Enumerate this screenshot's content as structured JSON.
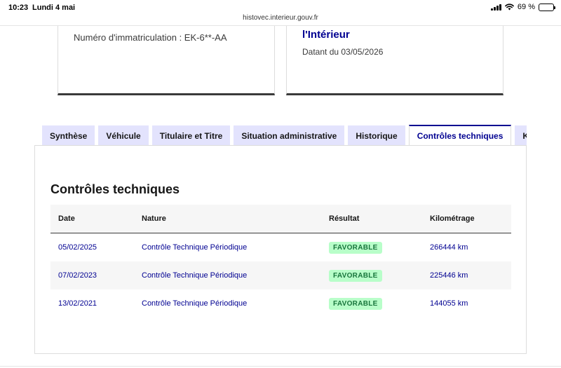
{
  "status_bar": {
    "time": "10:23",
    "date": "Lundi 4 mai",
    "battery": "69 %",
    "battery_level": 0.69
  },
  "browser": {
    "url": "histovec.interieur.gouv.fr"
  },
  "cards": {
    "plate_text": "Numéro d'immatriculation : EK-6**-AA",
    "ministry_text": "l'Intérieur",
    "dated_text": "Datant du 03/05/2026"
  },
  "tabs": [
    {
      "label": "Synthèse"
    },
    {
      "label": "Véhicule"
    },
    {
      "label": "Titulaire et Titre"
    },
    {
      "label": "Situation administrative"
    },
    {
      "label": "Historique"
    },
    {
      "label": "Contrôles techniques"
    },
    {
      "label": "Kilométrage"
    }
  ],
  "active_tab": "Contrôles techniques",
  "section": {
    "title": "Contrôles techniques"
  },
  "table": {
    "headers": [
      "Date",
      "Nature",
      "Résultat",
      "Kilométrage"
    ],
    "rows": [
      {
        "date": "05/02/2025",
        "nature": "Contrôle Technique Périodique",
        "result": "FAVORABLE",
        "mileage": "266444 km"
      },
      {
        "date": "07/02/2023",
        "nature": "Contrôle Technique Périodique",
        "result": "FAVORABLE",
        "mileage": "225446 km"
      },
      {
        "date": "13/02/2021",
        "nature": "Contrôle Technique Périodique",
        "result": "FAVORABLE",
        "mileage": "144055 km"
      }
    ]
  },
  "colors": {
    "primary_blue": "#000091",
    "tab_bg": "#e3e3fd",
    "success_bg": "#b8fec9",
    "success_text": "#18753c"
  }
}
